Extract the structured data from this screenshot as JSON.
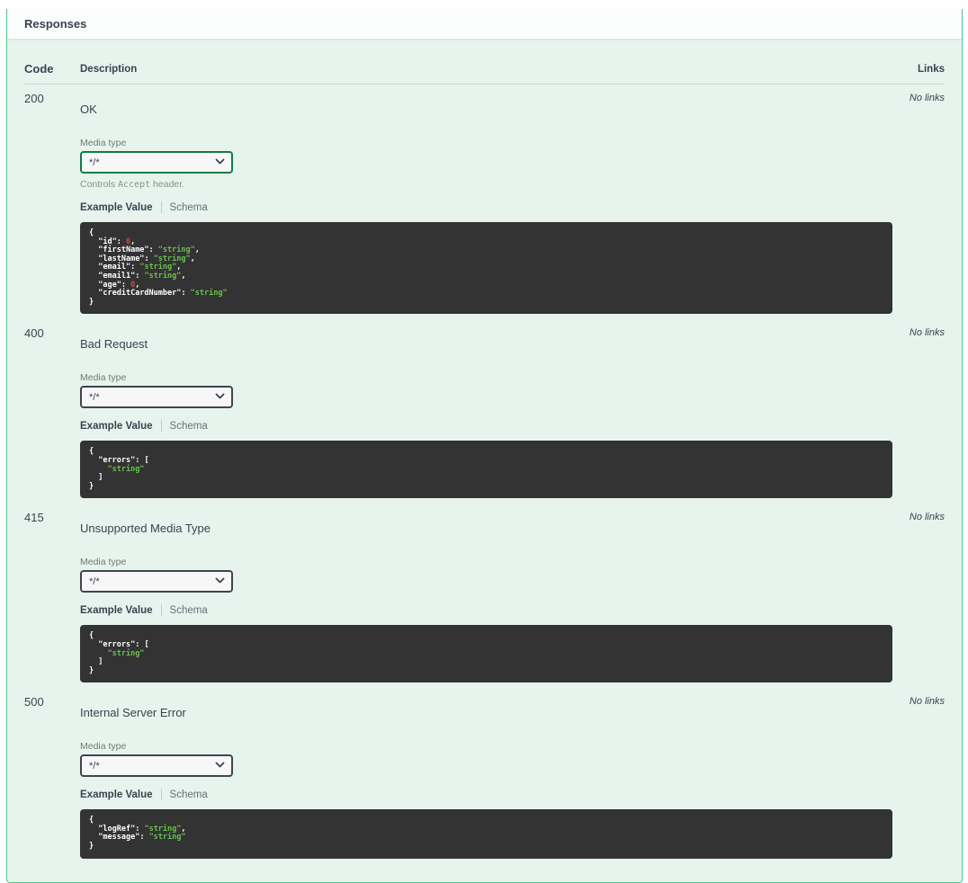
{
  "panel": {
    "title": "Responses",
    "table_headers": {
      "code": "Code",
      "description": "Description",
      "links": "Links"
    }
  },
  "media_type": {
    "label": "Media type",
    "selected_option": "*/*",
    "controls_accept_prefix": "Controls ",
    "controls_accept_code": "Accept",
    "controls_accept_suffix": " header."
  },
  "tabs": {
    "example": "Example Value",
    "schema": "Schema"
  },
  "colors": {
    "opblock_border_green": "#49cc90",
    "opblock_background": "#e6f4ed",
    "accept_select_border": "#0b7f44",
    "code_background": "#333333",
    "code_key": "#ffffff",
    "code_string": "#6ac14e",
    "code_number": "#ca4a3f"
  },
  "responses": [
    {
      "code": "200",
      "description": "OK",
      "links": "No links",
      "accept_controller": true,
      "example_lines": [
        [
          {
            "t": "{",
            "c": "p"
          }
        ],
        [
          {
            "t": "  ",
            "c": "p"
          },
          {
            "t": "\"id\"",
            "c": "k"
          },
          {
            "t": ": ",
            "c": "p"
          },
          {
            "t": "0",
            "c": "n"
          },
          {
            "t": ",",
            "c": "p"
          }
        ],
        [
          {
            "t": "  ",
            "c": "p"
          },
          {
            "t": "\"firstName\"",
            "c": "k"
          },
          {
            "t": ": ",
            "c": "p"
          },
          {
            "t": "\"string\"",
            "c": "s"
          },
          {
            "t": ",",
            "c": "p"
          }
        ],
        [
          {
            "t": "  ",
            "c": "p"
          },
          {
            "t": "\"lastName\"",
            "c": "k"
          },
          {
            "t": ": ",
            "c": "p"
          },
          {
            "t": "\"string\"",
            "c": "s"
          },
          {
            "t": ",",
            "c": "p"
          }
        ],
        [
          {
            "t": "  ",
            "c": "p"
          },
          {
            "t": "\"email\"",
            "c": "k"
          },
          {
            "t": ": ",
            "c": "p"
          },
          {
            "t": "\"string\"",
            "c": "s"
          },
          {
            "t": ",",
            "c": "p"
          }
        ],
        [
          {
            "t": "  ",
            "c": "p"
          },
          {
            "t": "\"email1\"",
            "c": "k"
          },
          {
            "t": ": ",
            "c": "p"
          },
          {
            "t": "\"string\"",
            "c": "s"
          },
          {
            "t": ",",
            "c": "p"
          }
        ],
        [
          {
            "t": "  ",
            "c": "p"
          },
          {
            "t": "\"age\"",
            "c": "k"
          },
          {
            "t": ": ",
            "c": "p"
          },
          {
            "t": "0",
            "c": "n"
          },
          {
            "t": ",",
            "c": "p"
          }
        ],
        [
          {
            "t": "  ",
            "c": "p"
          },
          {
            "t": "\"creditCardNumber\"",
            "c": "k"
          },
          {
            "t": ": ",
            "c": "p"
          },
          {
            "t": "\"string\"",
            "c": "s"
          }
        ],
        [
          {
            "t": "}",
            "c": "p"
          }
        ]
      ]
    },
    {
      "code": "400",
      "description": "Bad Request",
      "links": "No links",
      "accept_controller": false,
      "example_lines": [
        [
          {
            "t": "{",
            "c": "p"
          }
        ],
        [
          {
            "t": "  ",
            "c": "p"
          },
          {
            "t": "\"errors\"",
            "c": "k"
          },
          {
            "t": ": [",
            "c": "p"
          }
        ],
        [
          {
            "t": "    ",
            "c": "p"
          },
          {
            "t": "\"string\"",
            "c": "s"
          }
        ],
        [
          {
            "t": "  ]",
            "c": "p"
          }
        ],
        [
          {
            "t": "}",
            "c": "p"
          }
        ]
      ]
    },
    {
      "code": "415",
      "description": "Unsupported Media Type",
      "links": "No links",
      "accept_controller": false,
      "example_lines": [
        [
          {
            "t": "{",
            "c": "p"
          }
        ],
        [
          {
            "t": "  ",
            "c": "p"
          },
          {
            "t": "\"errors\"",
            "c": "k"
          },
          {
            "t": ": [",
            "c": "p"
          }
        ],
        [
          {
            "t": "    ",
            "c": "p"
          },
          {
            "t": "\"string\"",
            "c": "s"
          }
        ],
        [
          {
            "t": "  ]",
            "c": "p"
          }
        ],
        [
          {
            "t": "}",
            "c": "p"
          }
        ]
      ]
    },
    {
      "code": "500",
      "description": "Internal Server Error",
      "links": "No links",
      "accept_controller": false,
      "example_lines": [
        [
          {
            "t": "{",
            "c": "p"
          }
        ],
        [
          {
            "t": "  ",
            "c": "p"
          },
          {
            "t": "\"logRef\"",
            "c": "k"
          },
          {
            "t": ": ",
            "c": "p"
          },
          {
            "t": "\"string\"",
            "c": "s"
          },
          {
            "t": ",",
            "c": "p"
          }
        ],
        [
          {
            "t": "  ",
            "c": "p"
          },
          {
            "t": "\"message\"",
            "c": "k"
          },
          {
            "t": ": ",
            "c": "p"
          },
          {
            "t": "\"string\"",
            "c": "s"
          }
        ],
        [
          {
            "t": "}",
            "c": "p"
          }
        ]
      ]
    }
  ]
}
